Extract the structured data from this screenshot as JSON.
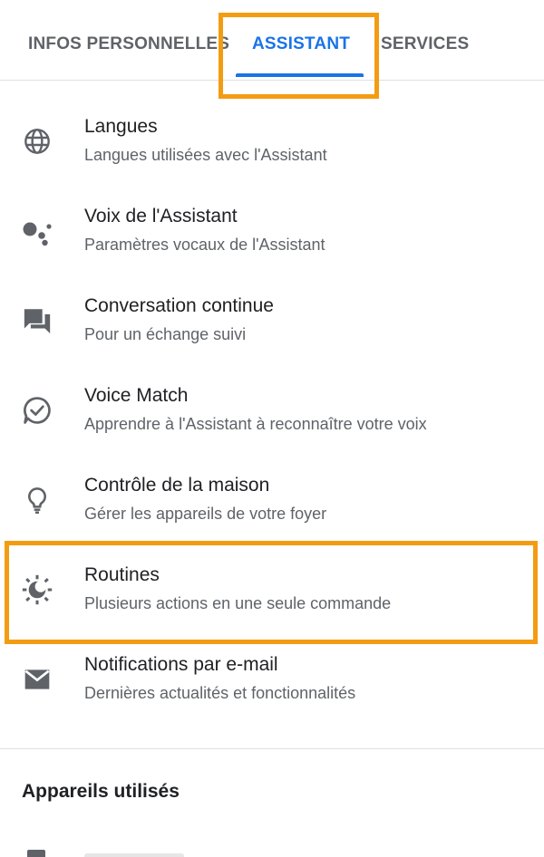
{
  "tabs": [
    {
      "label": "INFOS PERSONNELLES",
      "active": false
    },
    {
      "label": "ASSISTANT",
      "active": true
    },
    {
      "label": "SERVICES",
      "active": false
    }
  ],
  "settings": [
    {
      "title": "Langues",
      "subtitle": "Langues utilisées avec l'Assistant",
      "icon": "globe-icon"
    },
    {
      "title": "Voix de l'Assistant",
      "subtitle": "Paramètres vocaux de l'Assistant",
      "icon": "assistant-dots-icon"
    },
    {
      "title": "Conversation continue",
      "subtitle": "Pour un échange suivi",
      "icon": "chat-bubbles-icon"
    },
    {
      "title": "Voice Match",
      "subtitle": "Apprendre à l'Assistant à reconnaître votre voix",
      "icon": "voice-match-check-icon"
    },
    {
      "title": "Contrôle de la maison",
      "subtitle": "Gérer les appareils de votre foyer",
      "icon": "lightbulb-icon"
    },
    {
      "title": "Routines",
      "subtitle": "Plusieurs actions en une seule commande",
      "icon": "routines-sun-moon-icon"
    },
    {
      "title": "Notifications par e-mail",
      "subtitle": "Dernières actualités et fonctionnalités",
      "icon": "email-icon"
    }
  ],
  "devices_section": {
    "title": "Appareils utilisés"
  },
  "colors": {
    "accent": "#1a73e8",
    "highlight": "#f39c12",
    "icon": "#5f6368"
  }
}
